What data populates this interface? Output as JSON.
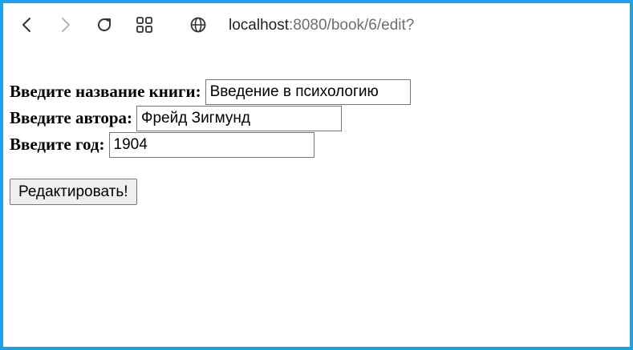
{
  "browser": {
    "url_host": "localhost",
    "url_path": ":8080/book/6/edit?",
    "icons": {
      "back": "back-arrow-icon",
      "forward": "forward-arrow-icon",
      "reload": "reload-icon",
      "apps": "apps-grid-icon",
      "site_info": "globe-icon"
    }
  },
  "form": {
    "title_label": "Введите название книги:",
    "title_value": "Введение в психологию",
    "author_label": "Введите автора:",
    "author_value": "Фрейд Зигмунд",
    "year_label": "Введите год:",
    "year_value": "1904",
    "submit_label": "Редактировать!"
  },
  "colors": {
    "window_border": "#1ea1e6",
    "url_path": "#6e6e6e"
  }
}
